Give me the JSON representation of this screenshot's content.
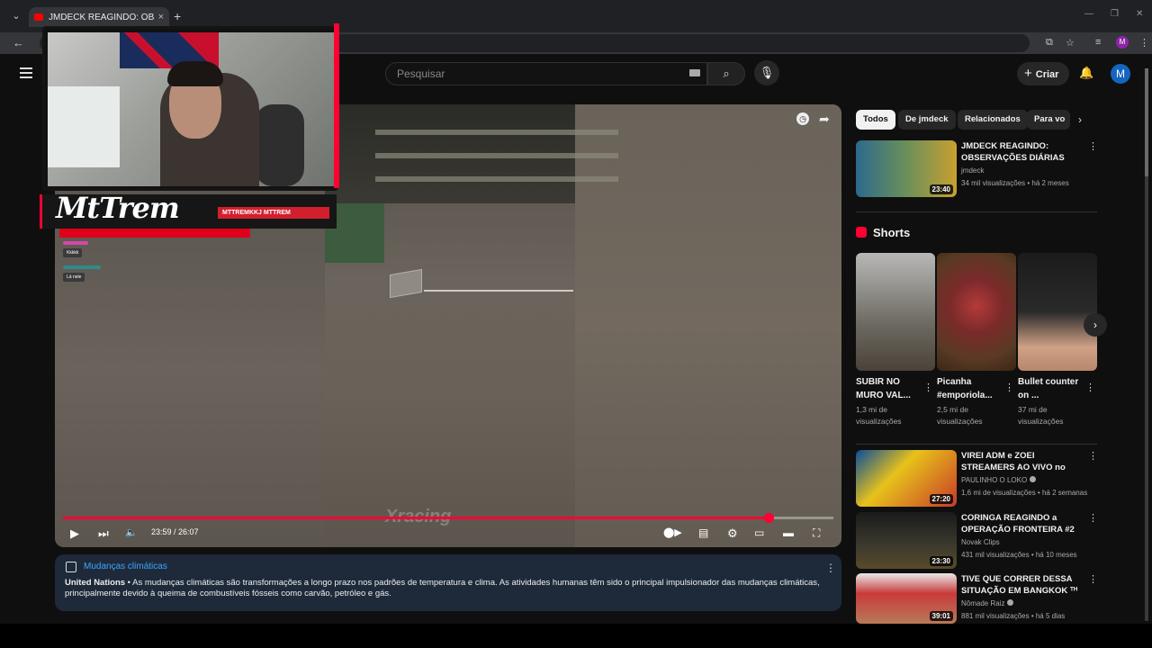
{
  "browser": {
    "tab_title": "JMDECK REAGINDO: OBSERVAÇ",
    "tab_close": "×",
    "new_tab": "+",
    "profile_initial": "M"
  },
  "header": {
    "search_placeholder": "Pesquisar",
    "create_label": "Criar",
    "avatar_initial": "M"
  },
  "player": {
    "time": "23:59 / 26:07",
    "progress_fraction": 0.916,
    "overlay": {
      "brand": "MtTrem",
      "social": "MTTREMKKJ   MTTREM",
      "chat": [
        "Kkkkk",
        "Lá nele"
      ]
    }
  },
  "info_panel": {
    "title": "Mudanças climáticas",
    "source": "United Nations",
    "text": " • As mudanças climáticas são transformações a longo prazo nos padrões de temperatura e clima. As atividades humanas têm sido o principal impulsionador das mudanças climáticas, principalmente devido à queima de combustíveis fósseis como carvão, petróleo e gás."
  },
  "sidebar": {
    "chips": [
      "Todos",
      "De jmdeck",
      "Relacionados",
      "Para vo"
    ],
    "top_video": {
      "title": "JMDECK REAGINDO: OBSERVAÇÕES DIÁRIAS (EP. ...",
      "channel": "jmdeck",
      "meta": "34 mil visualizações • há 2 meses",
      "duration": "23:40"
    },
    "shorts_heading": "Shorts",
    "shorts": [
      {
        "title": "SUBIR NO MURO VAL...",
        "views": "1,3 mi de visualizações"
      },
      {
        "title": "Picanha #emporiola...",
        "views": "2,5 mi de visualizações"
      },
      {
        "title": "Bullet counter on ...",
        "views": "37 mi de visualizações"
      }
    ],
    "videos": [
      {
        "title": "VIREI ADM e ZOEI STREAMERS AO VIVO no GTA RP! ...",
        "channel": "PAULINHO O LOKO",
        "meta": "1,6 mi de visualizações • há 2 semanas",
        "duration": "27:20"
      },
      {
        "title": "CORINGA REAGINDO a OPERAÇÃO FRONTEIRA #2",
        "channel": "Novak Clips",
        "meta": "431 mil visualizações • há 10 meses",
        "duration": "23:30"
      },
      {
        "title": "TIVE QUE CORRER DESSA SITUAÇÃO EM BANGKOK ᵀᴴ",
        "channel": "Nômade Raiz",
        "meta": "881 mil visualizações • há 5 dias",
        "duration": "39:01"
      }
    ]
  },
  "colors": {
    "accent": "#ff0033",
    "link": "#3ea6ff",
    "info_bg": "#1e2a3a"
  }
}
